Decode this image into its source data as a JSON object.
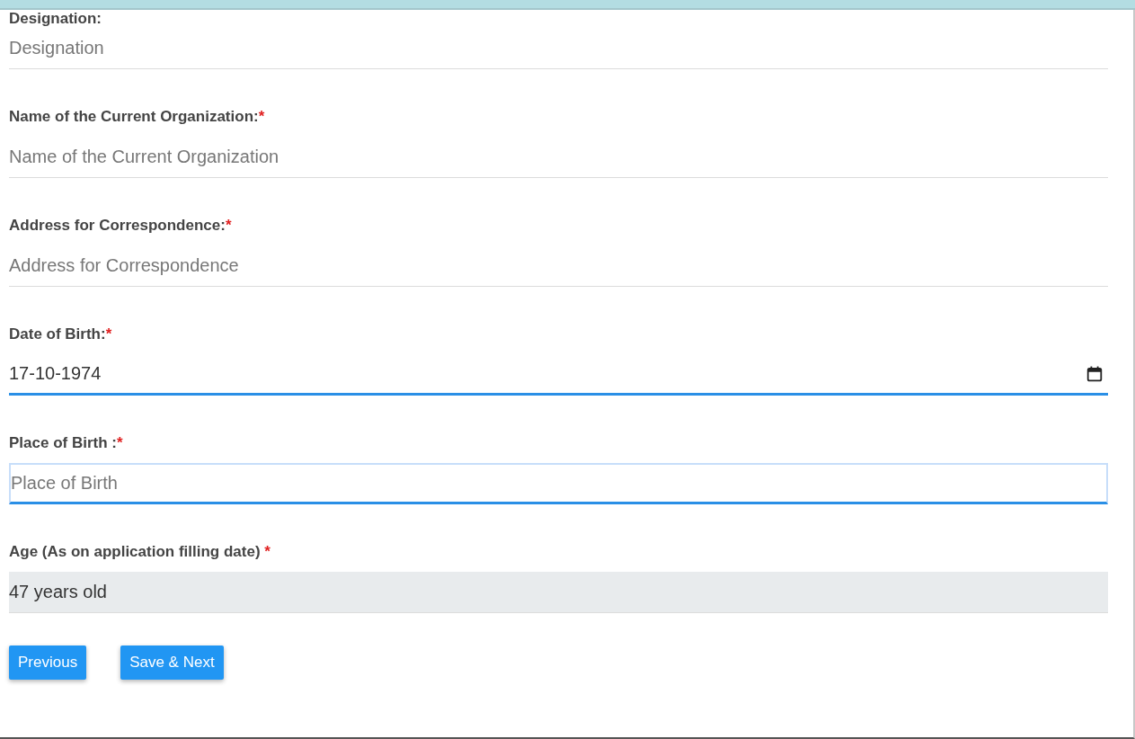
{
  "fields": [
    {
      "label": "Designation:",
      "kind": "text",
      "placeholder": "Designation",
      "focused": false
    },
    {
      "label": "Name of the Current Organization:",
      "required_mark": "*",
      "kind": "text",
      "placeholder": "Name of the Current Organization",
      "focused": false
    },
    {
      "label": "Address for Correspondence:",
      "required_mark": "*",
      "kind": "text",
      "placeholder": "Address for Correspondence",
      "focused": false
    },
    {
      "label": "Date of Birth:",
      "required_mark": "*",
      "kind": "date",
      "value": "17-10-1974",
      "focused": true
    },
    {
      "label": "Place of Birth :",
      "required_mark": "*",
      "kind": "text",
      "placeholder": "Place of Birth",
      "focused": true
    },
    {
      "label": "Age (As on application filling date) ",
      "required_mark": "*",
      "kind": "readonly",
      "value": "47 years old",
      "focused": false
    }
  ],
  "buttons": [
    "Previous",
    "Save & Next"
  ]
}
